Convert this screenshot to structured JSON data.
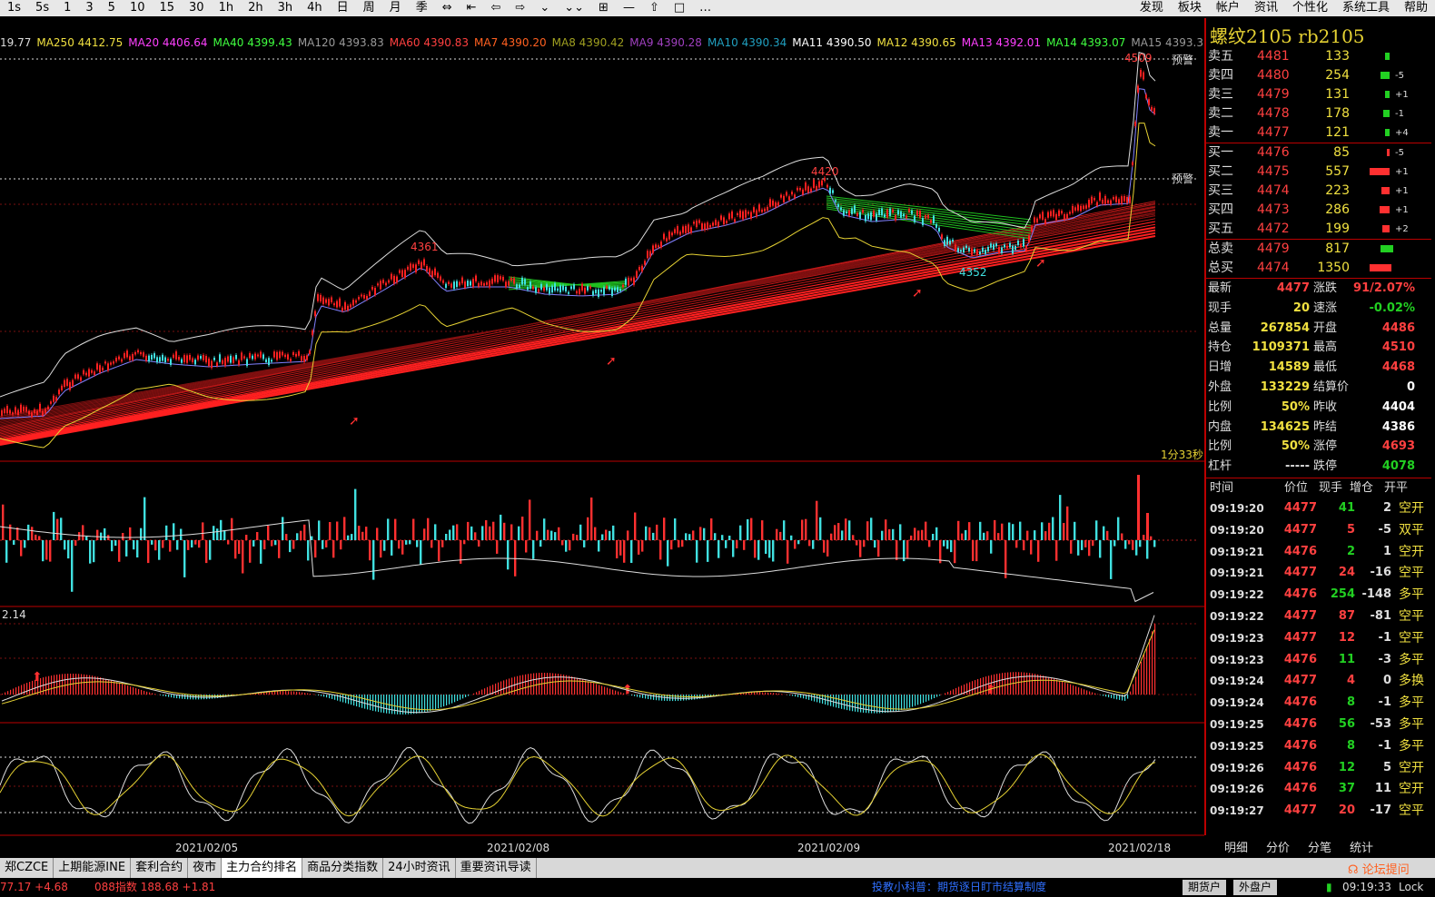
{
  "toolbar": {
    "items": [
      "1s",
      "5s",
      "1",
      "3",
      "5",
      "10",
      "15",
      "30",
      "1h",
      "2h",
      "3h",
      "4h",
      "日",
      "周",
      "月",
      "季",
      "⇔",
      "⇤",
      "⇦",
      "⇨",
      "⌄",
      "⌄⌄",
      "⊞",
      "—",
      "⇧",
      "□",
      "…"
    ],
    "right": [
      "发现",
      "板块",
      "帐户",
      "资讯",
      "个性化",
      "系统工具",
      "帮助"
    ]
  },
  "ma_bar": [
    {
      "text": "19.77",
      "color": "#dddddd"
    },
    {
      "text": "MA250 4412.75",
      "color": "#f0e040"
    },
    {
      "text": "MA20 4406.64",
      "color": "#ff40ff"
    },
    {
      "text": "MA40 4399.43",
      "color": "#40ff40"
    },
    {
      "text": "MA120 4393.83",
      "color": "#999999"
    },
    {
      "text": "MA60 4390.83",
      "color": "#ff4040"
    },
    {
      "text": "MA7 4390.20",
      "color": "#ff6020"
    },
    {
      "text": "MA8 4390.42",
      "color": "#a0a020"
    },
    {
      "text": "MA9 4390.28",
      "color": "#a040c0"
    },
    {
      "text": "MA10 4390.34",
      "color": "#20a0c0"
    },
    {
      "text": "MA11 4390.50",
      "color": "#ffffff"
    },
    {
      "text": "MA12 4390.65",
      "color": "#f0e040"
    },
    {
      "text": "MA13 4392.01",
      "color": "#ff40ff"
    },
    {
      "text": "MA14 4393.07",
      "color": "#40ff40"
    },
    {
      "text": "MA15 4393.31",
      "color": "#999999"
    }
  ],
  "chart": {
    "labels": {
      "high": "4420",
      "left_high": "4361",
      "low": "4352",
      "top": "4509"
    },
    "alerts": [
      "预警",
      "预警"
    ],
    "countdown": "1分33秒",
    "macd_value": "2.14",
    "dates": [
      "2021/02/05",
      "2021/02/08",
      "2021/02/09",
      "2021/02/18"
    ]
  },
  "panel": {
    "title": "螺纹2105  rb2105",
    "asks": [
      {
        "label": "卖五",
        "price": "4481",
        "vol": "133",
        "chg": ""
      },
      {
        "label": "卖四",
        "price": "4480",
        "vol": "254",
        "chg": "-5"
      },
      {
        "label": "卖三",
        "price": "4479",
        "vol": "131",
        "chg": "+1"
      },
      {
        "label": "卖二",
        "price": "4478",
        "vol": "178",
        "chg": "-1"
      },
      {
        "label": "卖一",
        "price": "4477",
        "vol": "121",
        "chg": "+4"
      }
    ],
    "bids": [
      {
        "label": "买一",
        "price": "4476",
        "vol": "85",
        "chg": "-5"
      },
      {
        "label": "买二",
        "price": "4475",
        "vol": "557",
        "chg": "+1"
      },
      {
        "label": "买三",
        "price": "4474",
        "vol": "223",
        "chg": "+1"
      },
      {
        "label": "买四",
        "price": "4473",
        "vol": "286",
        "chg": "+1"
      },
      {
        "label": "买五",
        "price": "4472",
        "vol": "199",
        "chg": "+2"
      }
    ],
    "totals": [
      {
        "label": "总卖",
        "price": "4479",
        "vol": "817"
      },
      {
        "label": "总买",
        "price": "4474",
        "vol": "1350"
      }
    ],
    "quotes": [
      {
        "k": "最新",
        "v": "4477",
        "vc": "#ff4040",
        "k2": "涨跌",
        "v2": "91/2.07%",
        "v2c": "#ff4040"
      },
      {
        "k": "现手",
        "v": "20",
        "vc": "#f0e040",
        "k2": "速涨",
        "v2": "-0.02%",
        "v2c": "#22d022"
      },
      {
        "k": "总量",
        "v": "267854",
        "vc": "#f0e040",
        "k2": "开盘",
        "v2": "4486",
        "v2c": "#ff4040"
      },
      {
        "k": "持仓",
        "v": "1109371",
        "vc": "#f0e040",
        "k2": "最高",
        "v2": "4510",
        "v2c": "#ff4040"
      },
      {
        "k": "日增",
        "v": "14589",
        "vc": "#f0e040",
        "k2": "最低",
        "v2": "4468",
        "v2c": "#ff4040"
      },
      {
        "k": "外盘",
        "v": "133229",
        "vc": "#f0e040",
        "k2": "结算价",
        "v2": "0",
        "v2c": "#ffffff"
      },
      {
        "k": "比例",
        "v": "50%",
        "vc": "#f0e040",
        "k2": "昨收",
        "v2": "4404",
        "v2c": "#ffffff"
      },
      {
        "k": "内盘",
        "v": "134625",
        "vc": "#f0e040",
        "k2": "昨结",
        "v2": "4386",
        "v2c": "#ffffff"
      },
      {
        "k": "比例",
        "v": "50%",
        "vc": "#f0e040",
        "k2": "涨停",
        "v2": "4693",
        "v2c": "#ff4040"
      },
      {
        "k": "杠杆",
        "v": "-----",
        "vc": "#dddddd",
        "k2": "跌停",
        "v2": "4078",
        "v2c": "#22d022"
      }
    ],
    "ticks_header": [
      "时间",
      "价位",
      "现手",
      "增仓",
      "开平"
    ],
    "ticks": [
      {
        "t": "09:19:20",
        "p": "4477",
        "n": "41",
        "z": "2",
        "o": "空开",
        "nc": "#22d022"
      },
      {
        "t": "09:19:20",
        "p": "4477",
        "n": "5",
        "z": "-5",
        "o": "双平",
        "nc": "#ff4040"
      },
      {
        "t": "09:19:21",
        "p": "4476",
        "n": "2",
        "z": "1",
        "o": "空开",
        "nc": "#22d022"
      },
      {
        "t": "09:19:21",
        "p": "4477",
        "n": "24",
        "z": "-16",
        "o": "空平",
        "nc": "#ff4040"
      },
      {
        "t": "09:19:22",
        "p": "4476",
        "n": "254",
        "z": "-148",
        "o": "多平",
        "nc": "#22d022"
      },
      {
        "t": "09:19:22",
        "p": "4477",
        "n": "87",
        "z": "-81",
        "o": "空平",
        "nc": "#ff4040"
      },
      {
        "t": "09:19:23",
        "p": "4477",
        "n": "12",
        "z": "-1",
        "o": "空平",
        "nc": "#ff4040"
      },
      {
        "t": "09:19:23",
        "p": "4476",
        "n": "11",
        "z": "-3",
        "o": "多平",
        "nc": "#22d022"
      },
      {
        "t": "09:19:24",
        "p": "4477",
        "n": "4",
        "z": "0",
        "o": "多换",
        "nc": "#ff4040"
      },
      {
        "t": "09:19:24",
        "p": "4476",
        "n": "8",
        "z": "-1",
        "o": "多平",
        "nc": "#22d022"
      },
      {
        "t": "09:19:25",
        "p": "4476",
        "n": "56",
        "z": "-53",
        "o": "多平",
        "nc": "#22d022"
      },
      {
        "t": "09:19:25",
        "p": "4476",
        "n": "8",
        "z": "-1",
        "o": "多平",
        "nc": "#22d022"
      },
      {
        "t": "09:19:26",
        "p": "4476",
        "n": "12",
        "z": "5",
        "o": "空开",
        "nc": "#22d022"
      },
      {
        "t": "09:19:26",
        "p": "4476",
        "n": "37",
        "z": "11",
        "o": "空开",
        "nc": "#22d022"
      },
      {
        "t": "09:19:27",
        "p": "4477",
        "n": "20",
        "z": "-17",
        "o": "空平",
        "nc": "#ff4040"
      }
    ],
    "detail_tabs": [
      "明细",
      "分价",
      "分笔",
      "统计"
    ],
    "forum": "论坛提问"
  },
  "bottom_tabs": [
    "郑CZCE",
    "上期能源INE",
    "套利合约",
    "夜市",
    "主力合约排名",
    "商品分类指数",
    "24小时资讯",
    "重要资讯导读"
  ],
  "status": {
    "left": "77.17  +4.68",
    "mid": "088指数  188.68  +1.81",
    "notice": "投教小科普：期货逐日盯市结算制度",
    "btn1": "期货户",
    "btn2": "外盘户",
    "time": "09:19:33",
    "lock": "Lock"
  }
}
